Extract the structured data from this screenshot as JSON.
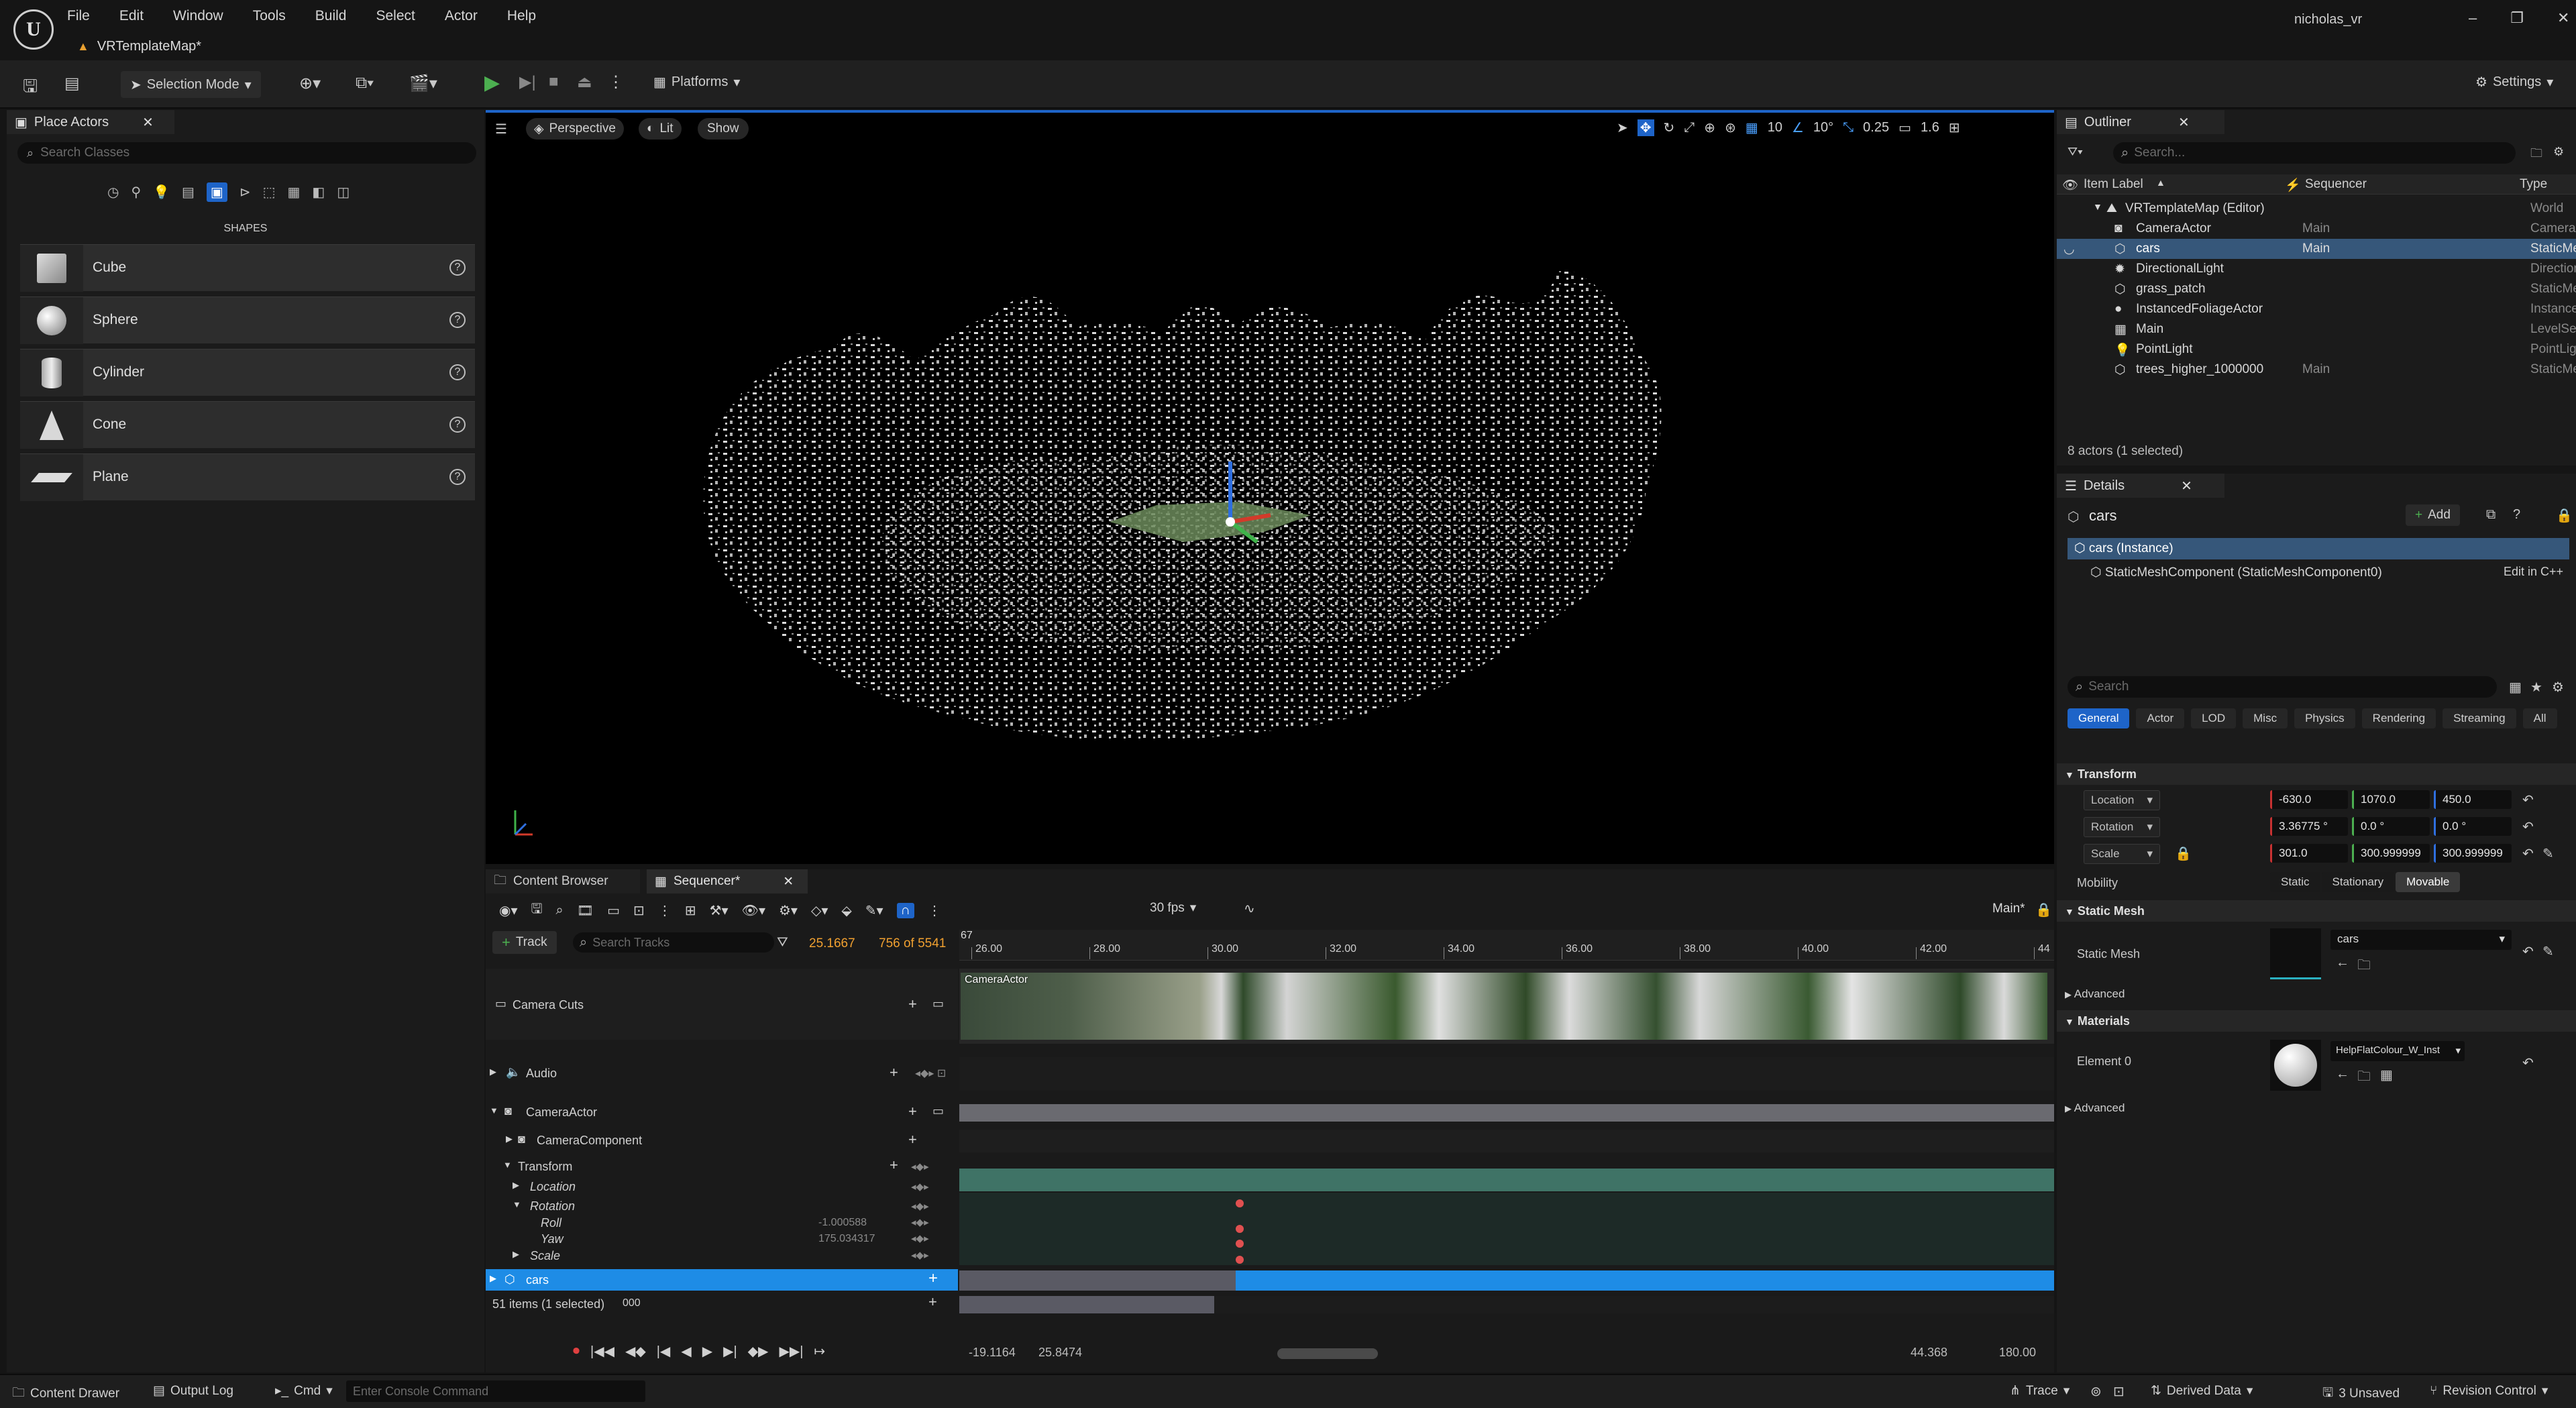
{
  "app": {
    "map_tab": "VRTemplateMap*",
    "user": "nicholas_vr",
    "menu": [
      "File",
      "Edit",
      "Window",
      "Tools",
      "Build",
      "Select",
      "Actor",
      "Help"
    ]
  },
  "toolbar": {
    "selection_mode": "Selection Mode",
    "platforms": "Platforms",
    "settings": "Settings"
  },
  "place_actors": {
    "tab": "Place Actors",
    "search_placeholder": "Search Classes",
    "category": "SHAPES",
    "items": [
      {
        "label": "Cube",
        "icon": "cube-icon"
      },
      {
        "label": "Sphere",
        "icon": "sphere-icon"
      },
      {
        "label": "Cylinder",
        "icon": "cylinder-icon"
      },
      {
        "label": "Cone",
        "icon": "cone-icon"
      },
      {
        "label": "Plane",
        "icon": "plane-icon"
      }
    ]
  },
  "viewport": {
    "perspective": "Perspective",
    "lit": "Lit",
    "show": "Show",
    "grid": "10",
    "angle": "10°",
    "scale": "0.25",
    "camera_speed": "1.6"
  },
  "outliner": {
    "tab": "Outliner",
    "search_placeholder": "Search...",
    "col_label": "Item Label",
    "col_seq": "Sequencer",
    "col_type": "Type",
    "rows": [
      {
        "label": "VRTemplateMap (Editor)",
        "seq": "",
        "type": "World"
      },
      {
        "label": "CameraActor",
        "seq": "Main",
        "type": "CameraActor"
      },
      {
        "label": "cars",
        "seq": "Main",
        "type": "StaticMeshActor"
      },
      {
        "label": "DirectionalLight",
        "seq": "",
        "type": "DirectionalLight"
      },
      {
        "label": "grass_patch",
        "seq": "",
        "type": "StaticMeshActor"
      },
      {
        "label": "InstancedFoliageActor",
        "seq": "",
        "type": "InstancedFoliageActor"
      },
      {
        "label": "Main",
        "seq": "",
        "type": "LevelSequenceActor"
      },
      {
        "label": "PointLight",
        "seq": "",
        "type": "PointLight"
      },
      {
        "label": "trees_higher_1000000",
        "seq": "Main",
        "type": "StaticMeshActor"
      }
    ],
    "footer": "8 actors (1 selected)"
  },
  "details": {
    "tab": "Details",
    "actor": "cars",
    "add": "Add",
    "instance": "cars (Instance)",
    "component": "StaticMeshComponent (StaticMeshComponent0)",
    "edit_cpp": "Edit in C++",
    "search_placeholder": "Search",
    "tabs": [
      "General",
      "Actor",
      "LOD",
      "Misc",
      "Physics",
      "Rendering",
      "Streaming",
      "All"
    ],
    "transform_header": "Transform",
    "location_label": "Location",
    "rotation_label": "Rotation",
    "scale_label": "Scale",
    "location": [
      "-630.0",
      "1070.0",
      "450.0"
    ],
    "rotation": [
      "3.36775 °",
      "0.0 °",
      "0.0 °"
    ],
    "scale": [
      "301.0",
      "300.999999",
      "300.999999"
    ],
    "mobility_label": "Mobility",
    "mobility": [
      "Static",
      "Stationary",
      "Movable"
    ],
    "static_mesh_header": "Static Mesh",
    "static_mesh_label": "Static Mesh",
    "static_mesh_value": "cars",
    "advanced": "Advanced",
    "materials_header": "Materials",
    "element0_label": "Element 0",
    "material_value": "HelpFlatColour_W_Inst"
  },
  "sequencer": {
    "tab_content": "Content Browser",
    "tab_seq": "Sequencer*",
    "fps": "30 fps",
    "main": "Main*",
    "track_btn": "Track",
    "search_placeholder": "Search Tracks",
    "current_time": "25.1667",
    "frame_count": "756 of 5541",
    "ruler_start": "67",
    "ruler_ticks": [
      "26.00",
      "28.00",
      "30.00",
      "32.00",
      "34.00",
      "36.00",
      "38.00",
      "40.00",
      "42.00",
      "44"
    ],
    "camera_cuts_label": "Camera Cuts",
    "camera_cuts_clip": "CameraActor",
    "tracks": [
      {
        "label": "Audio",
        "value": ""
      },
      {
        "label": "CameraActor",
        "value": ""
      },
      {
        "label": "CameraComponent",
        "value": ""
      },
      {
        "label": "Transform",
        "value": ""
      },
      {
        "label": "Location",
        "value": ""
      },
      {
        "label": "Rotation",
        "value": ""
      },
      {
        "label": "Roll",
        "value": "-1.000588"
      },
      {
        "label": "Yaw",
        "value": "175.034317"
      },
      {
        "label": "Scale",
        "value": ""
      },
      {
        "label": "cars",
        "value": ""
      }
    ],
    "partial_track": "000",
    "items_status": "51 items (1 selected)",
    "view_start": "-19.1164",
    "view_in": "25.8474",
    "view_out": "44.368",
    "view_end": "180.00"
  },
  "statusbar": {
    "content_drawer": "Content Drawer",
    "output_log": "Output Log",
    "cmd": "Cmd",
    "console_placeholder": "Enter Console Command",
    "trace": "Trace",
    "derived_data": "Derived Data",
    "unsaved": "3 Unsaved",
    "revision": "Revision Control"
  },
  "colors": {
    "accent": "#1e64c8",
    "selection": "#2699e6",
    "play": "#4caf50",
    "key": "#e05050",
    "transform_lane": "#3f7366"
  }
}
